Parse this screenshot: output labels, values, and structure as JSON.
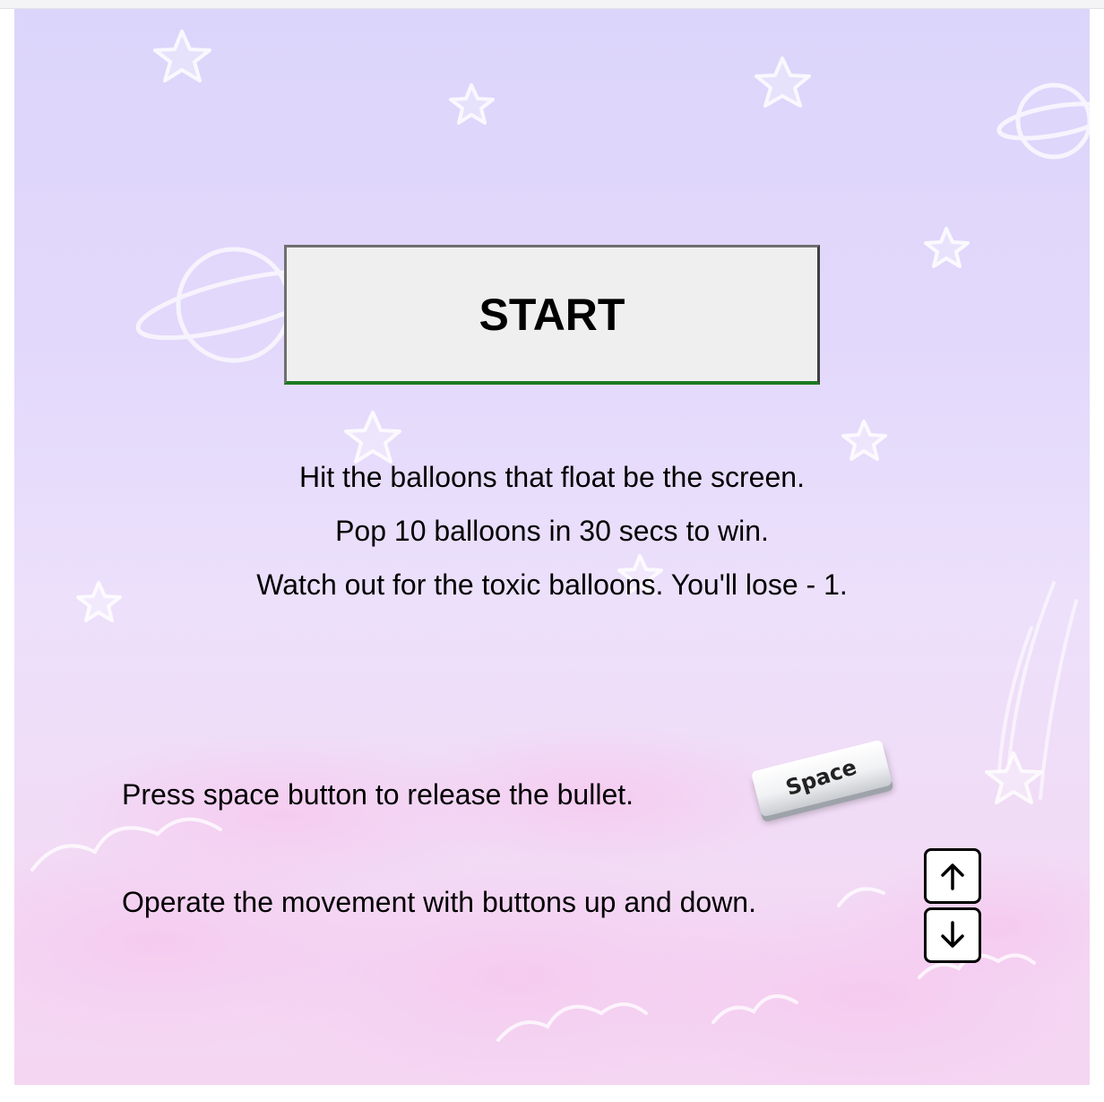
{
  "start_button": {
    "label": "START"
  },
  "rules": [
    "Hit the balloons that float be the screen.",
    "Pop 10 balloons in 30 secs to win.",
    "Watch out for the toxic balloons. You'll lose - 1."
  ],
  "controls": {
    "shoot_text": "Press space button to release the bullet.",
    "space_key_label": "Space",
    "move_text": "Operate the movement with buttons up and down.",
    "up_key_icon": "arrow-up-icon",
    "down_key_icon": "arrow-down-icon"
  },
  "colors": {
    "sky_top": "#dcd5fb",
    "sky_bottom": "#f4d6f2",
    "start_button_bg": "#efefef",
    "start_button_bottom_border": "#1c7a22"
  }
}
